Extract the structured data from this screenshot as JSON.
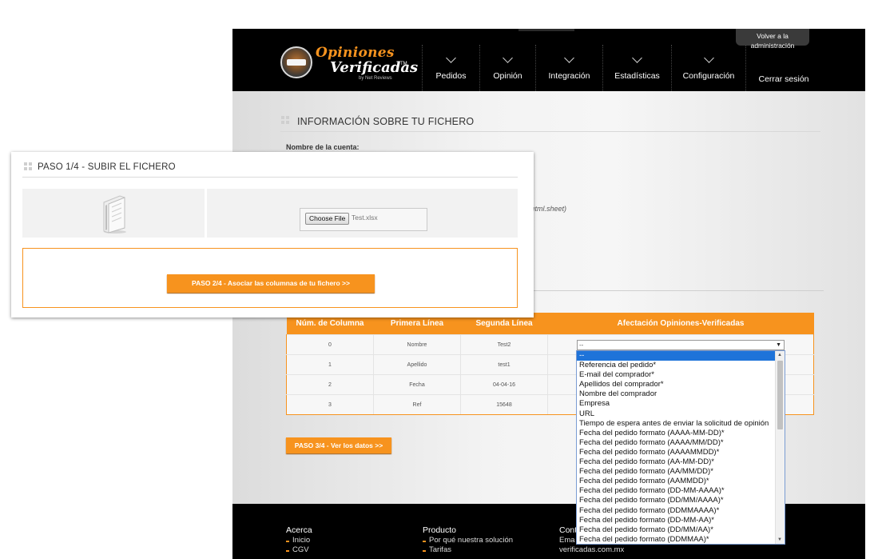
{
  "brand": {
    "name_line1": "Opiniones",
    "name_line2": "Verificadas",
    "trademark": "TM",
    "tagline": "by Net Reviews",
    "orange": "#f7931e"
  },
  "topbar": {
    "back_admin_line1": "Volver a la",
    "back_admin_line2": "administración",
    "nav": [
      "Pedidos",
      "Opinión",
      "Integración",
      "Estadísticas",
      "Configuración"
    ],
    "logout": "Cerrar sesión"
  },
  "info": {
    "title": "INFORMACIÓN SOBRE TU FICHERO",
    "account_label": "Nombre de la cuenta:",
    "mime_fragment": "ıtml.sheet)"
  },
  "mapping": {
    "headers": [
      "Núm. de Columna",
      "Primera Línea",
      "Segunda Línea",
      "Afectación Opiniones-Verificadas"
    ],
    "rows": [
      {
        "col": "0",
        "first": "Nombre",
        "second": "Test2"
      },
      {
        "col": "1",
        "first": "Apellido",
        "second": "test1"
      },
      {
        "col": "2",
        "first": "Fecha",
        "second": "04-04-16"
      },
      {
        "col": "3",
        "first": "Ref",
        "second": "15648"
      }
    ],
    "select_value": "--",
    "next_button": "PASO 3/4 - Ver los datos >>"
  },
  "dropdown": {
    "options": [
      "--",
      "Referencia del pedido*",
      "E-mail del comprador*",
      "Apellidos del comprador*",
      "Nombre del comprador",
      "Empresa",
      "URL",
      "Tiempo de espera antes de enviar la solicitud de opinión",
      "Fecha del pedido formato (AAAA-MM-DD)*",
      "Fecha del pedido formato (AAAA/MM/DD)*",
      "Fecha del pedido formato (AAAAMMDD)*",
      "Fecha del pedido formato (AA-MM-DD)*",
      "Fecha del pedido formato (AA/MM/DD)*",
      "Fecha del pedido formato (AAMMDD)*",
      "Fecha del pedido formato (DD-MM-AAAA)*",
      "Fecha del pedido formato (DD/MM/AAAA)*",
      "Fecha del pedido formato (DDMMAAAA)*",
      "Fecha del pedido formato (DD-MM-AA)*",
      "Fecha del pedido formato (DD/MM/AA)*",
      "Fecha del pedido formato (DDMMAA)*"
    ],
    "selected_index": 0
  },
  "footer": {
    "col1": {
      "heading": "Acerca",
      "items": [
        "Inicio",
        "CGV"
      ]
    },
    "col2": {
      "heading": "Producto",
      "items": [
        "Por qué nuestra solución",
        "Tarifas"
      ]
    },
    "col3": {
      "heading": "Cont",
      "line1": "Ema",
      "line2": "verificadas.com.mx"
    }
  },
  "panel": {
    "title": "PASO 1/4 - SUBIR EL FICHERO",
    "choose_file": "Choose File",
    "file_name": "Test.xlsx",
    "next_button": "PASO 2/4 - Asociar las columnas de tu fichero >>"
  }
}
